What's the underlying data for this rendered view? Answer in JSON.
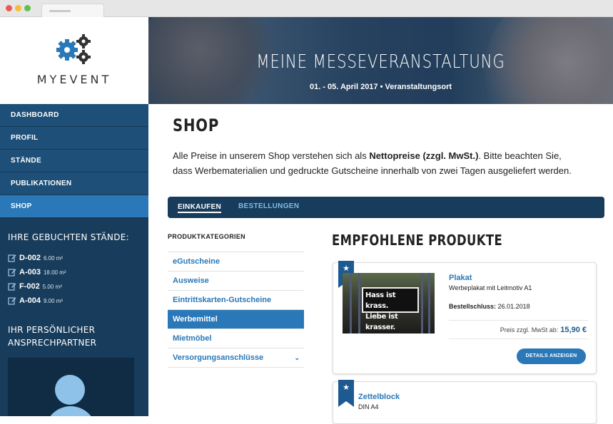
{
  "brand": {
    "name": "MYEVENT"
  },
  "colors": {
    "accent": "#2a78b7",
    "sidebar": "#183c5b",
    "nav": "#1d4f78"
  },
  "nav": {
    "items": [
      {
        "label": "DASHBOARD"
      },
      {
        "label": "PROFIL"
      },
      {
        "label": "STÄNDE"
      },
      {
        "label": "PUBLIKATIONEN"
      },
      {
        "label": "SHOP",
        "active": true
      }
    ]
  },
  "stands": {
    "title": "IHRE GEBUCHTEN STÄNDE:",
    "items": [
      {
        "id": "D-002",
        "size": "6.00 m²"
      },
      {
        "id": "A-003",
        "size": "18.00 m²"
      },
      {
        "id": "F-002",
        "size": "5.00 m²"
      },
      {
        "id": "A-004",
        "size": "9.00 m²"
      }
    ]
  },
  "contact": {
    "title_line1": "IHR PERSÖNLICHER",
    "title_line2": "ANSPRECHPARTNER"
  },
  "banner": {
    "title": "MEINE MESSEVERANSTALTUNG",
    "subtitle": "01. - 05. April 2017 • Veranstaltungsort"
  },
  "page": {
    "title": "SHOP",
    "intro_part1": "Alle Preise in unserem Shop verstehen sich als ",
    "intro_bold": "Nettopreise (zzgl. MwSt.)",
    "intro_part2": ". Bitte beachten Sie, dass Werbematerialien und gedruckte Gutscheine innerhalb von zwei Tagen ausgeliefert werden."
  },
  "tabs": [
    {
      "label": "EINKAUFEN",
      "active": true
    },
    {
      "label": "BESTELLUNGEN"
    }
  ],
  "categories": {
    "title": "PRODUKTKATEGORIEN",
    "items": [
      {
        "label": "eGutscheine"
      },
      {
        "label": "Ausweise"
      },
      {
        "label": "Eintrittskarten-Gutscheine"
      },
      {
        "label": "Werbemittel",
        "active": true
      },
      {
        "label": "Mietmöbel"
      },
      {
        "label": "Versorgungsanschlüsse",
        "expandable": true
      }
    ]
  },
  "products": {
    "heading": "EMPFOHLENE PRODUKTE",
    "items": [
      {
        "name": "Plakat",
        "description": "Werbeplakat mit Leitmotiv A1",
        "deadline_label": "Bestellschluss:",
        "deadline": "26.01.2018",
        "price_label": "Preis zzgl. MwSt ab:",
        "price": "15,90 €",
        "button": "DETAILS ANZEIGEN",
        "image_text_line1": "Hass ist krass.",
        "image_text_line2": "Liebe ist krasser."
      },
      {
        "name": "Zettelblock",
        "description": "DIN A4"
      }
    ]
  },
  "icons": {
    "logo": "gears-icon",
    "edit": "edit-icon",
    "star": "star-icon",
    "avatar": "user-avatar-icon",
    "chevron": "chevron-down-icon"
  }
}
